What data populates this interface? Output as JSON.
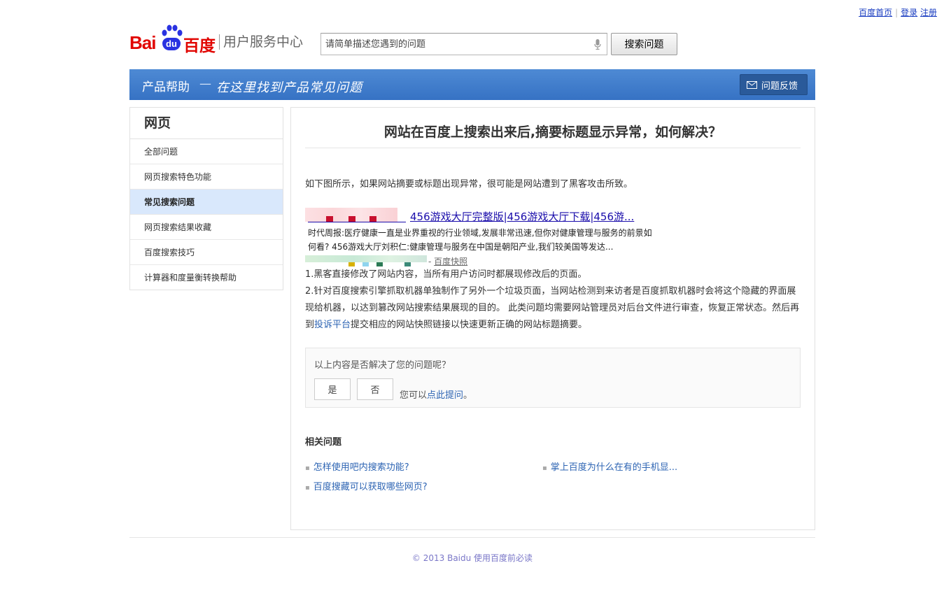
{
  "top_links": {
    "home": "百度首页",
    "separator": "|",
    "login": "登录",
    "register": "注册"
  },
  "header": {
    "logo_bai": "Bai",
    "logo_du": "du",
    "logo_cn": "百度",
    "logo_service": "用户服务中心",
    "search_placeholder": "请简单描述您遇到的问题",
    "search_button": "搜索问题"
  },
  "banner": {
    "title": "产品帮助",
    "dash": "—",
    "slogan": "在这里找到产品常见问题",
    "feedback_button": "问题反馈"
  },
  "sidebar": {
    "title": "网页",
    "items": [
      {
        "label": "全部问题"
      },
      {
        "label": "网页搜索特色功能"
      },
      {
        "label": "常见搜索问题"
      },
      {
        "label": "网页搜索结果收藏"
      },
      {
        "label": "百度搜索技巧"
      },
      {
        "label": "计算器和度量衡转换帮助"
      }
    ],
    "active_index": 2
  },
  "article": {
    "title": "网站在百度上搜索出来后,摘要标题显示异常，如何解决？",
    "intro": "如下图所示，如果网站摘要或标题出现异常，很可能是网站遭到了黑客攻击所致。",
    "example": {
      "title": "456游戏大厅完整版|456游戏大厅下载|456游...",
      "line1": "时代周报:医疗健康一直是业界重视的行业领域,发展非常迅速,但你对健康管理与服务的前景如",
      "line2": "何看? 456游戏大厅刘积仁:健康管理与服务在中国是朝阳产业,我们较美国等发达...",
      "cache_prefix": "- ",
      "cache": "百度快照"
    },
    "point1": "1.黑客直接修改了网站内容，当所有用户访问时都展现修改后的页面。",
    "point2_a": "2.针对百度搜索引擎抓取机器单独制作了另外一个垃圾页面，当网站检测到来访者是百度抓取机器时会将这个隐藏的界面展现给机器，以达到篡改网站搜索结果展现的目的。 此类问题均需要网站管理员对后台文件进行审查，恢复正常状态。然后再到",
    "point2_link": "投诉平台",
    "point2_b": "提交相应的网站快照链接以快速更新正确的网站标题摘要。"
  },
  "vote": {
    "question": "以上内容是否解决了您的问题呢？",
    "yes": "是",
    "no": "否",
    "ask_prefix": "您可以",
    "ask_link": "点此提问",
    "ask_suffix": "。"
  },
  "related": {
    "title": "相关问题",
    "items": [
      {
        "label": "怎样使用吧内搜索功能?"
      },
      {
        "label": "掌上百度为什么在有的手机显..."
      },
      {
        "label": "百度搜藏可以获取哪些网页?"
      }
    ]
  },
  "footer": {
    "text": "© 2013 Baidu 使用百度前必读"
  },
  "colors": {
    "brand_red": "#e10602",
    "brand_blue": "#2932e1",
    "banner_blue": "#3f7bcc",
    "link": "#2d64b3"
  }
}
